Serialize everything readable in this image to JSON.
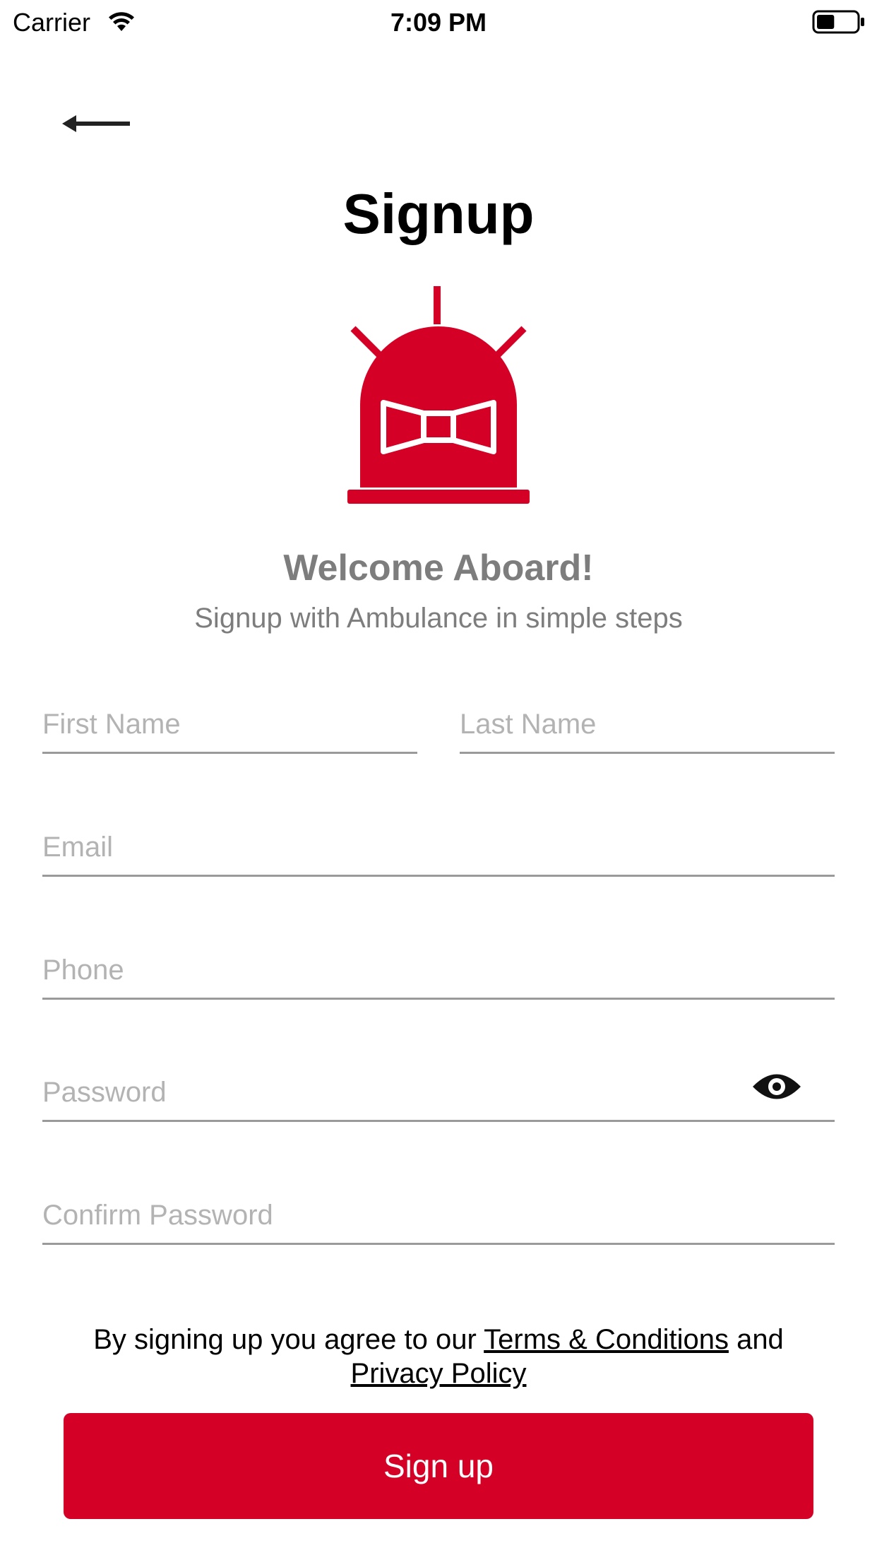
{
  "status_bar": {
    "carrier": "Carrier",
    "time": "7:09 PM",
    "wifi_icon": "wifi-icon",
    "battery_icon": "battery-icon",
    "battery_level": 0.45
  },
  "header": {
    "back_icon": "arrow-left-icon",
    "title": "Signup"
  },
  "logo": {
    "icon": "siren-alarm-icon",
    "color": "#d50026"
  },
  "welcome": {
    "title": "Welcome Aboard!",
    "subtitle": "Signup with Ambulance in simple steps"
  },
  "form": {
    "first_name": {
      "placeholder": "First Name",
      "value": ""
    },
    "last_name": {
      "placeholder": "Last Name",
      "value": ""
    },
    "email": {
      "placeholder": "Email",
      "value": ""
    },
    "phone": {
      "placeholder": "Phone",
      "value": ""
    },
    "password": {
      "placeholder": "Password",
      "value": "",
      "toggle_icon": "eye-icon"
    },
    "confirm_password": {
      "placeholder": "Confirm Password",
      "value": ""
    }
  },
  "terms": {
    "prefix": "By signing up you agree to our ",
    "terms_link": "Terms & Conditions",
    "middle": " and",
    "privacy_link": "Privacy Policy"
  },
  "actions": {
    "signup_label": "Sign up",
    "signup_color": "#d50026"
  }
}
